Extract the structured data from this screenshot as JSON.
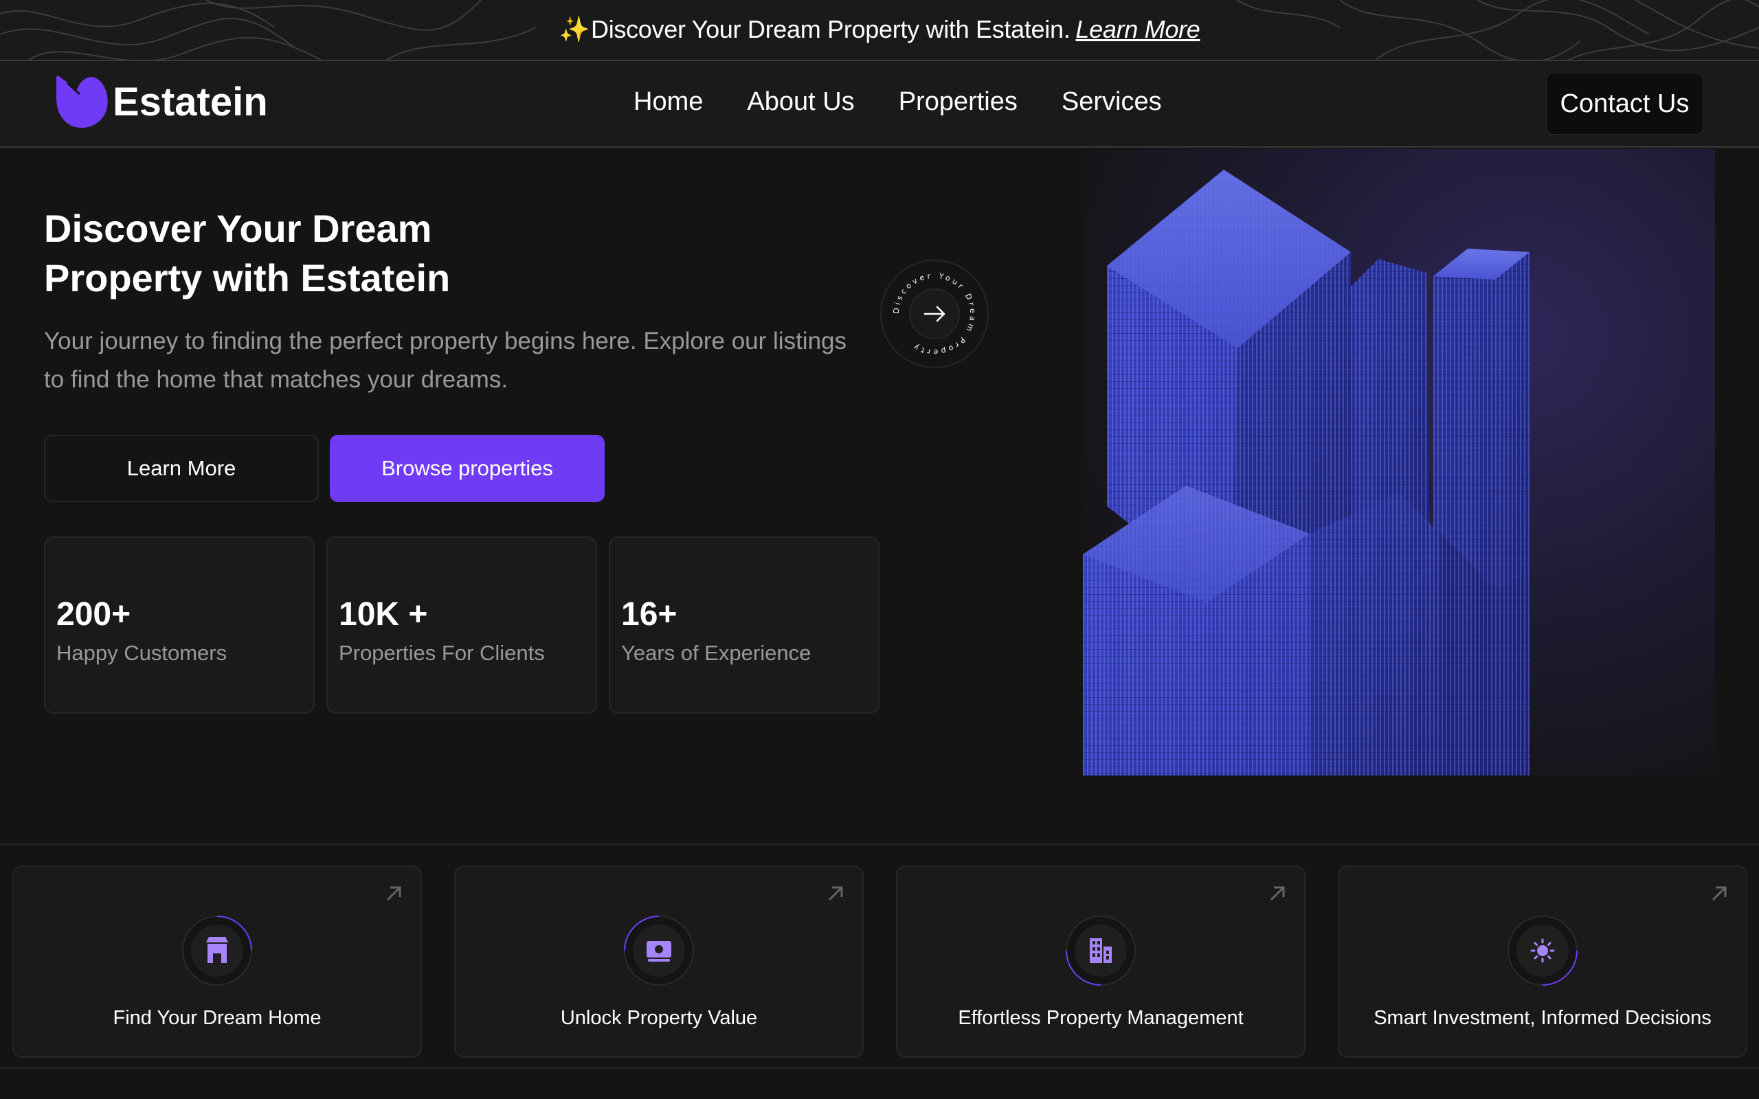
{
  "banner": {
    "sparkle_icon": "sparkle-icon",
    "message": "Discover Your Dream Property with Estatein.",
    "link": "Learn More"
  },
  "navbar": {
    "brand": "Estatein",
    "logo_color": "#703bf7",
    "links": [
      "Home",
      "About Us",
      "Properties",
      "Services"
    ],
    "contact": "Contact Us"
  },
  "hero": {
    "title": "Discover Your Dream Property with Estatein",
    "subtitle": "Your journey to finding the perfect property begins here. Explore our listings to find the home that matches your dreams.",
    "learn_more": "Learn More",
    "browse": "Browse properties",
    "accent": "#703bf7",
    "badge_text": "Discover Your Dream Property",
    "stats": [
      {
        "value": "200+",
        "label": "Happy Customers"
      },
      {
        "value": "10K +",
        "label": "Properties For Clients"
      },
      {
        "value": "16+",
        "label": "Years of Experience"
      }
    ]
  },
  "features": [
    {
      "label": "Find Your Dream Home",
      "icon": "house-icon"
    },
    {
      "label": "Unlock Property Value",
      "icon": "money-icon"
    },
    {
      "label": "Effortless Property Management",
      "icon": "building-icon"
    },
    {
      "label": "Smart Investment, Informed Decisions",
      "icon": "sun-icon"
    }
  ]
}
